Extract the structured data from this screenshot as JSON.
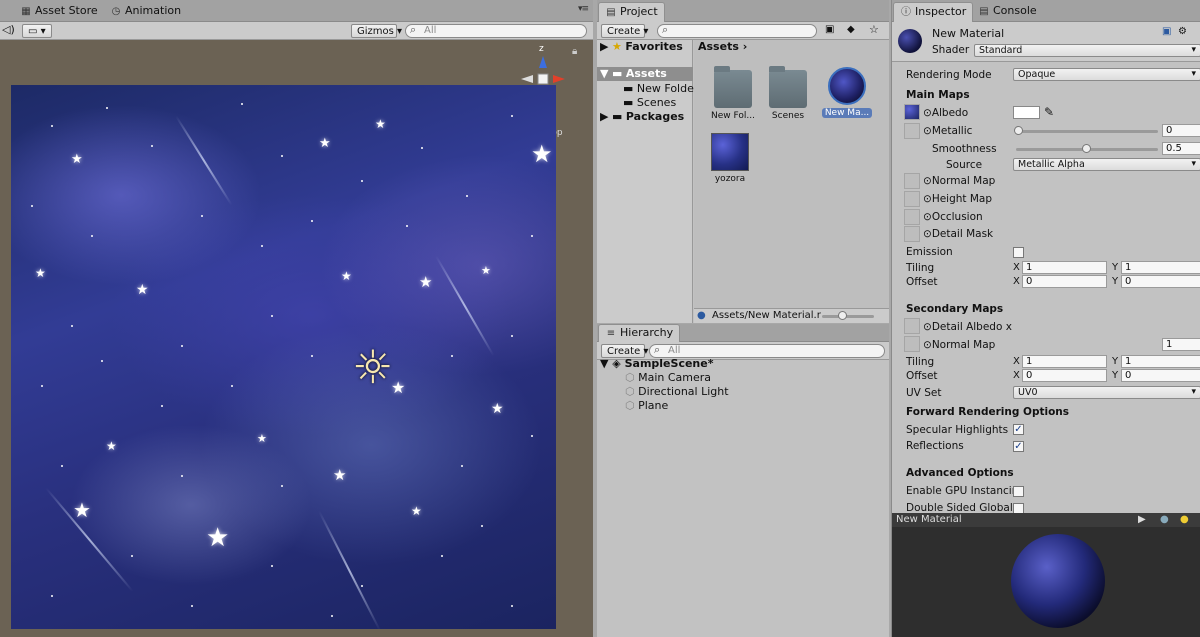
{
  "scene": {
    "tabs": [
      {
        "label": "Asset Store",
        "icon": "store-icon"
      },
      {
        "label": "Animation",
        "icon": "clock-icon"
      }
    ],
    "gizmos_label": "Gizmos",
    "search_placeholder": "All",
    "gizmo_axis_label": "z",
    "gizmo_view_label": "Top"
  },
  "project": {
    "tab": "Project",
    "create_label": "Create",
    "tree": {
      "favorites": "Favorites",
      "assets": "Assets",
      "children": [
        "New Folder",
        "Scenes"
      ],
      "packages": "Packages"
    },
    "breadcrumb": "Assets",
    "assets": [
      {
        "label": "New Fol...",
        "type": "folder"
      },
      {
        "label": "Scenes",
        "type": "folder"
      },
      {
        "label": "New Ma...",
        "type": "material"
      },
      {
        "label": "yozora",
        "type": "texture"
      }
    ],
    "status_path": "Assets/New Material.r"
  },
  "hierarchy": {
    "tab": "Hierarchy",
    "create_label": "Create",
    "search_placeholder": "All",
    "scene_name": "SampleScene*",
    "objects": [
      "Main Camera",
      "Directional Light",
      "Plane"
    ]
  },
  "inspector": {
    "tabs": [
      "Inspector",
      "Console"
    ],
    "material_name": "New Material",
    "shader_label": "Shader",
    "shader_value": "Standard",
    "rendering_mode_label": "Rendering Mode",
    "rendering_mode_value": "Opaque",
    "main_maps": "Main Maps",
    "albedo": "Albedo",
    "metallic": "Metallic",
    "metallic_value": "0",
    "smoothness": "Smoothness",
    "smoothness_value": "0.5",
    "source": "Source",
    "source_value": "Metallic Alpha",
    "normal_map": "Normal Map",
    "height_map": "Height Map",
    "occlusion": "Occlusion",
    "detail_mask": "Detail Mask",
    "emission": "Emission",
    "tiling": "Tiling",
    "offset": "Offset",
    "x": "X",
    "y": "Y",
    "tiling_x": "1",
    "tiling_y": "1",
    "offset_x": "0",
    "offset_y": "0",
    "secondary_maps": "Secondary Maps",
    "detail_albedo": "Detail Albedo x",
    "sec_normal_map": "Normal Map",
    "sec_normal_value": "1",
    "sec_tiling_x": "1",
    "sec_tiling_y": "1",
    "sec_offset_x": "0",
    "sec_offset_y": "0",
    "uv_set": "UV Set",
    "uv_set_value": "UV0",
    "forward_options": "Forward Rendering Options",
    "specular_highlights": "Specular Highlights",
    "reflections": "Reflections",
    "advanced_options": "Advanced Options",
    "gpu_instancing": "Enable GPU Instancin",
    "double_sided": "Double Sided Global",
    "preview_title": "New Material",
    "check_mark": "✓"
  }
}
